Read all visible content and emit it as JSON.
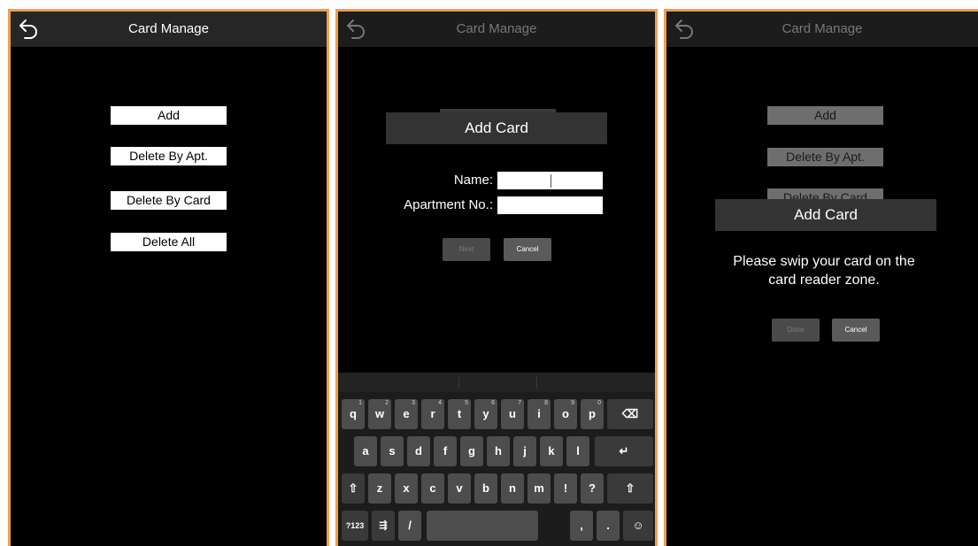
{
  "screen1": {
    "title": "Card Manage",
    "buttons": {
      "add": "Add",
      "delete_by_apt": "Delete By Apt.",
      "delete_by_card": "Delete By Card",
      "delete_all": "Delete All"
    }
  },
  "screen2": {
    "title": "Card Manage",
    "dialog_title": "Add Card",
    "name_label": "Name:",
    "name_value": "",
    "apartment_label": "Apartment No.:",
    "apartment_value": "",
    "next_label": "Next",
    "cancel_label": "Cancel",
    "keyboard": {
      "row1": [
        {
          "k": "q",
          "n": "1"
        },
        {
          "k": "w",
          "n": "2"
        },
        {
          "k": "e",
          "n": "3"
        },
        {
          "k": "r",
          "n": "4"
        },
        {
          "k": "t",
          "n": "5"
        },
        {
          "k": "y",
          "n": "6"
        },
        {
          "k": "u",
          "n": "7"
        },
        {
          "k": "i",
          "n": "8"
        },
        {
          "k": "o",
          "n": "9"
        },
        {
          "k": "p",
          "n": "0"
        }
      ],
      "row2": [
        "a",
        "s",
        "d",
        "f",
        "g",
        "h",
        "j",
        "k",
        "l"
      ],
      "row3": [
        "z",
        "x",
        "c",
        "v",
        "b",
        "n",
        "m",
        "!",
        "?"
      ],
      "symbols_key": "?123",
      "settings_key": "⇶",
      "slash_key": "/",
      "comma_key": ",",
      "period_key": ".",
      "enter_key": "↵",
      "shift_key": "⇧",
      "backspace_key": "⌫",
      "emoji_key": "☺"
    }
  },
  "screen3": {
    "title": "Card Manage",
    "buttons": {
      "add": "Add",
      "delete_by_apt": "Delete By Apt.",
      "delete_by_card": "Delete By Card"
    },
    "dialog_title": "Add Card",
    "message": "Please swip your card on the\ncard reader zone.",
    "done_label": "Done",
    "cancel_label": "Cancel"
  },
  "colors": {
    "frame_border": "#f0a04b",
    "screen_bg": "#000000",
    "topbar_bg": "#262626",
    "dialog_title_bg": "#333333"
  }
}
